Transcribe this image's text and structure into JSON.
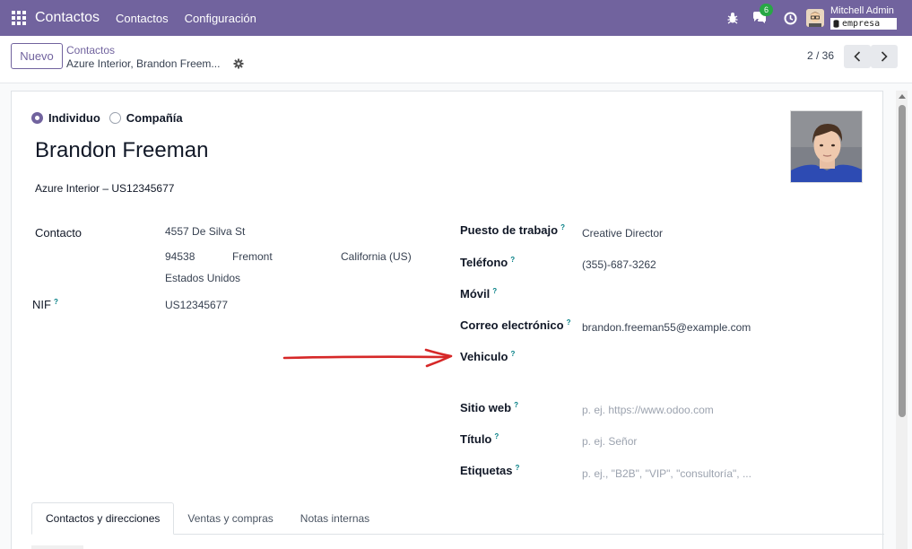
{
  "navbar": {
    "app_title": "Contactos",
    "menu": [
      "Contactos",
      "Configuración"
    ],
    "chat_count": "6",
    "user_name": "Mitchell Admin",
    "company_name": "empresa",
    "accent": "#71639e",
    "icons": [
      "apps-grid-icon",
      "bug-icon",
      "chat-icon",
      "clock-icon",
      "avatar"
    ]
  },
  "control_panel": {
    "new_button": "Nuevo",
    "breadcrumb_parent": "Contactos",
    "breadcrumb_current": "Azure Interior, Brandon Freem...",
    "pager": "2 / 36"
  },
  "form": {
    "type_options": [
      "Individuo",
      "Compañía"
    ],
    "type_selected": "Individuo",
    "name": "Brandon Freeman",
    "company": "Azure Interior – US12345677",
    "left": {
      "contact_label": "Contacto",
      "street": "4557 De Silva St",
      "zip": "94538",
      "city": "Fremont",
      "state": "California (US)",
      "country": "Estados Unidos",
      "vat_label": "NIF",
      "vat": "US12345677"
    },
    "right": {
      "job_label": "Puesto de trabajo",
      "job": "Creative Director",
      "phone_label": "Teléfono",
      "phone": "(355)-687-3262",
      "mobile_label": "Móvil",
      "email_label": "Correo electrónico",
      "email": "brandon.freeman55@example.com",
      "vehicle_label": "Vehiculo",
      "website_label": "Sitio web",
      "website_placeholder": "p. ej. https://www.odoo.com",
      "title_label": "Título",
      "title_placeholder": "p. ej. Señor",
      "tags_label": "Etiquetas",
      "tags_placeholder": "p. ej., \"B2B\", \"VIP\", \"consultoría\", ..."
    },
    "help_mark": "?"
  },
  "tabs": [
    "Contactos y direcciones",
    "Ventas y compras",
    "Notas internas"
  ],
  "active_tab": "Contactos y direcciones",
  "annotation_arrow_color": "#d62828"
}
